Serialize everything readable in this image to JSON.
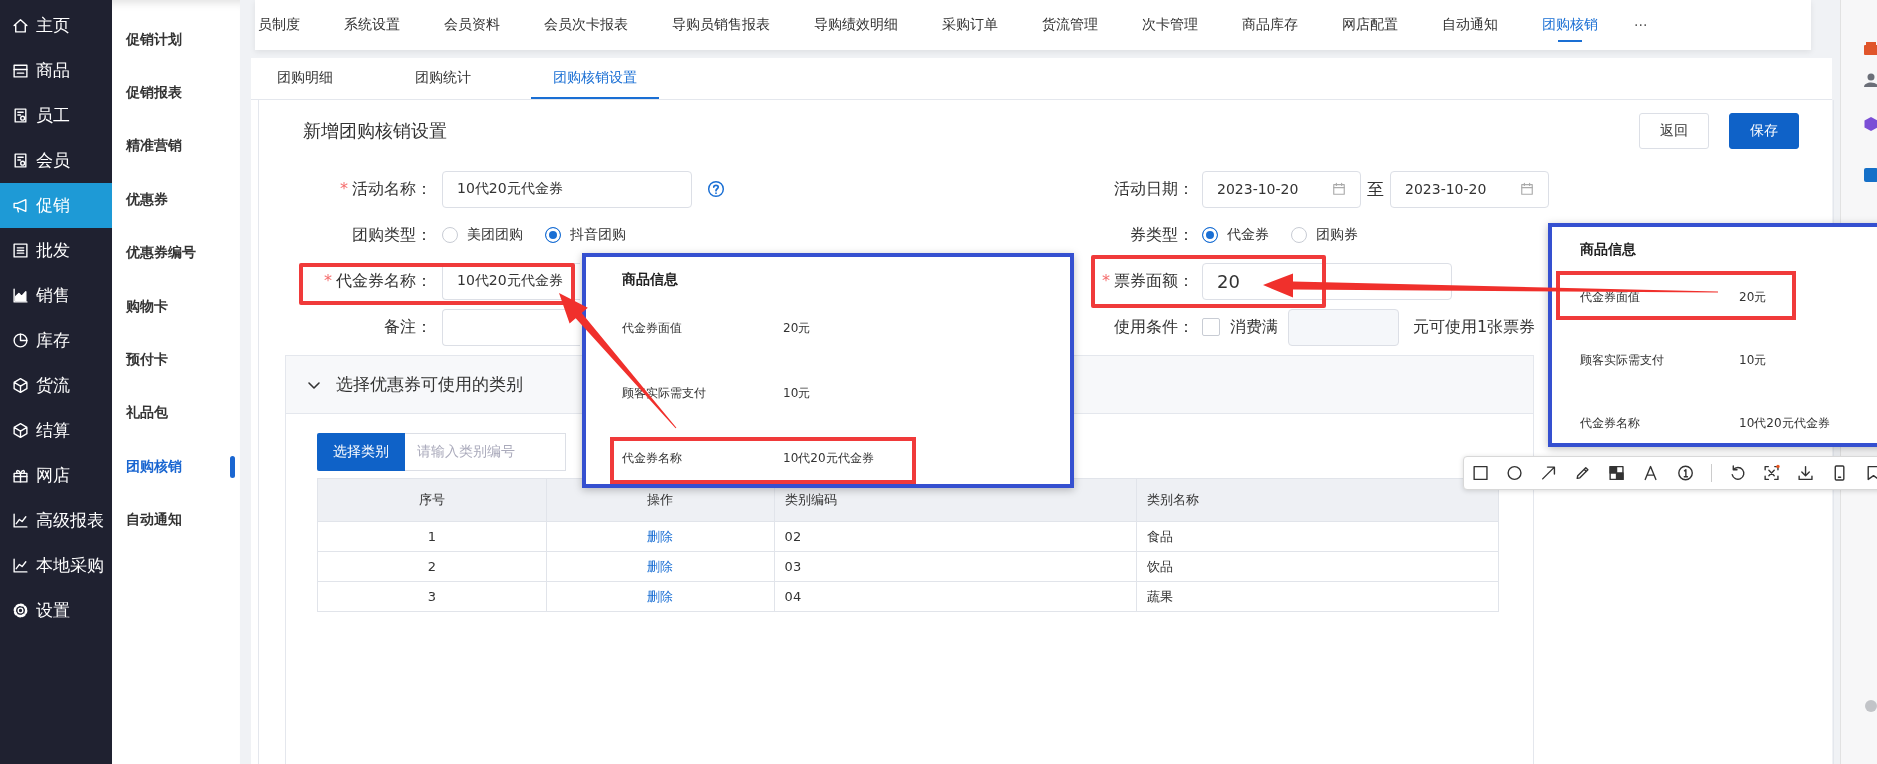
{
  "nav": {
    "items": [
      {
        "label": "主页",
        "selected": false
      },
      {
        "label": "商品",
        "selected": false
      },
      {
        "label": "员工",
        "selected": false
      },
      {
        "label": "会员",
        "selected": false
      },
      {
        "label": "促销",
        "selected": true
      },
      {
        "label": "批发",
        "selected": false
      },
      {
        "label": "销售",
        "selected": false
      },
      {
        "label": "库存",
        "selected": false
      },
      {
        "label": "货流",
        "selected": false
      },
      {
        "label": "结算",
        "selected": false
      },
      {
        "label": "网店",
        "selected": false
      },
      {
        "label": "高级报表",
        "selected": false
      },
      {
        "label": "本地采购",
        "selected": false
      },
      {
        "label": "设置",
        "selected": false
      }
    ]
  },
  "subnav": {
    "items": [
      {
        "label": "促销计划",
        "selected": false
      },
      {
        "label": "促销报表",
        "selected": false
      },
      {
        "label": "精准营销",
        "selected": false
      },
      {
        "label": "优惠券",
        "selected": false
      },
      {
        "label": "优惠券编号",
        "selected": false
      },
      {
        "label": "购物卡",
        "selected": false
      },
      {
        "label": "预付卡",
        "selected": false
      },
      {
        "label": "礼品包",
        "selected": false
      },
      {
        "label": "团购核销",
        "selected": true
      },
      {
        "label": "自动通知",
        "selected": false
      }
    ]
  },
  "top_tabs": {
    "items": [
      {
        "label": "员制度",
        "selected": false
      },
      {
        "label": "系统设置",
        "selected": false
      },
      {
        "label": "会员资料",
        "selected": false
      },
      {
        "label": "会员次卡报表",
        "selected": false
      },
      {
        "label": "导购员销售报表",
        "selected": false
      },
      {
        "label": "导购绩效明细",
        "selected": false
      },
      {
        "label": "采购订单",
        "selected": false
      },
      {
        "label": "货流管理",
        "selected": false
      },
      {
        "label": "次卡管理",
        "selected": false
      },
      {
        "label": "商品库存",
        "selected": false
      },
      {
        "label": "网店配置",
        "selected": false
      },
      {
        "label": "自动通知",
        "selected": false
      },
      {
        "label": "团购核销",
        "selected": true
      }
    ],
    "more": "···"
  },
  "sub_tabs": [
    {
      "label": "团购明细",
      "selected": false
    },
    {
      "label": "团购统计",
      "selected": false
    },
    {
      "label": "团购核销设置",
      "selected": true
    }
  ],
  "page": {
    "title": "新增团购核销设置",
    "buttons": [
      {
        "label": "返回",
        "kind": "default"
      },
      {
        "label": "保存",
        "kind": "primary"
      }
    ]
  },
  "form": {
    "activity_name": {
      "required_mark": "*",
      "label": "活动名称：",
      "value": "10代20元代金券"
    },
    "activity_date": {
      "label": "活动日期：",
      "start": "2023-10-20",
      "separator": "至",
      "end": "2023-10-20"
    },
    "group_type": {
      "label": "团购类型：",
      "options": [
        {
          "label": "美团团购",
          "selected": false
        },
        {
          "label": "抖音团购",
          "selected": true
        }
      ]
    },
    "coupon_type": {
      "label": "券类型：",
      "options": [
        {
          "label": "代金券",
          "selected": true
        },
        {
          "label": "团购券",
          "selected": false
        }
      ]
    },
    "coupon_name": {
      "required_mark": "*",
      "label": "代金券名称：",
      "value": "10代20元代金券",
      "highlighted": true
    },
    "face_value": {
      "required_mark": "*",
      "label": "票券面额：",
      "value": "20",
      "highlighted": true
    },
    "remark": {
      "label": "备注："
    },
    "use_condition": {
      "label": "使用条件：",
      "checkbox": {
        "label": "消费满",
        "checked": false
      },
      "suffix": "元可使用1张票券"
    }
  },
  "category_section": {
    "title": "选择优惠券可使用的类别",
    "expanded": true,
    "button": "选择类别",
    "search_placeholder": "请输入类别编号",
    "table": {
      "columns": [
        "序号",
        "操作",
        "类别编码",
        "类别名称"
      ],
      "rows": [
        {
          "index": "1",
          "action": "删除",
          "code": "02",
          "name": "食品"
        },
        {
          "index": "2",
          "action": "删除",
          "code": "03",
          "name": "饮品"
        },
        {
          "index": "3",
          "action": "删除",
          "code": "04",
          "name": "蔬果"
        }
      ]
    }
  },
  "pasted_screenshots": [
    {
      "title": "商品信息",
      "rows": [
        {
          "label": "代金券面值",
          "value": "20元",
          "highlighted": false
        },
        {
          "label": "顾客实际需支付",
          "value": "10元",
          "highlighted": false
        },
        {
          "label": "代金券名称",
          "value": "10代20元代金券",
          "highlighted": true
        }
      ]
    },
    {
      "title": "商品信息",
      "rows": [
        {
          "label": "代金券面值",
          "value": "20元",
          "highlighted": true
        },
        {
          "label": "顾客实际需支付",
          "value": "10元",
          "highlighted": false
        },
        {
          "label": "代金券名称",
          "value": "10代20元代金券",
          "highlighted": false
        }
      ]
    }
  ]
}
